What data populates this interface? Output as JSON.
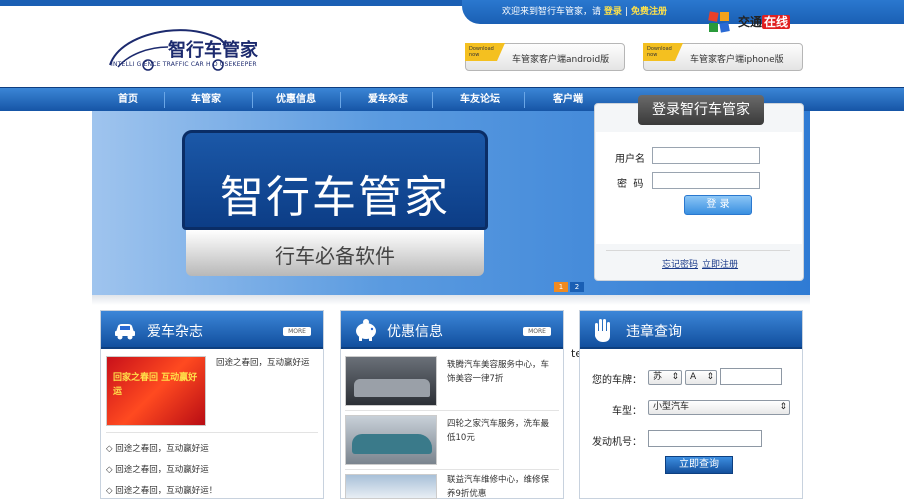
{
  "header": {
    "welcome": "欢迎来到智行车管家，请",
    "login_link": "登录",
    "separator": "|",
    "register_link": "免费注册",
    "logo_title": "智行车管家",
    "logo_sub": "INTELLI G ENCE TRAFFIC CAR H O USEKEEPER",
    "partner": "交通",
    "partner_highlight": "在线",
    "download_tag": "Download now",
    "download_android": "车管家客户端android版",
    "download_iphone": "车管家客户端iphone版"
  },
  "nav": {
    "items": [
      "首页",
      "车管家",
      "优惠信息",
      "爱车杂志",
      "车友论坛",
      "客户端"
    ]
  },
  "banner": {
    "title": "智行车管家",
    "subtitle": "行车必备软件",
    "pages": [
      "1",
      "2"
    ]
  },
  "login": {
    "title": "登录智行车管家",
    "username_label": "用户名",
    "password_label": "密  码",
    "submit": "登  录",
    "forgot": "忘记密码",
    "register": "立即注册"
  },
  "magazine": {
    "title": "爱车杂志",
    "more": "MORE",
    "image_caption": "回家之春回 互动赢好运",
    "headline": "回途之春回，互动赢好运",
    "items": [
      "回途之春回，互动赢好运",
      "回途之春回，互动赢好运",
      "回途之春回，互动赢好运！"
    ]
  },
  "deals": {
    "title": "优惠信息",
    "more": "MORE",
    "items": [
      "轶腾汽车美容服务中心，车饰美容一律7折",
      "四轮之家汽车服务，洗车最低10元",
      "联益汽车维修中心，维修保养9折优惠"
    ]
  },
  "stray_text": "te",
  "query": {
    "title": "违章查询",
    "plate_label": "您的车牌：",
    "province": "苏",
    "letter": "A",
    "type_label": "车型：",
    "type_value": "小型汽车",
    "engine_label": "发动机号：",
    "submit": "立即查询"
  },
  "colors": {
    "brand_blue": "#1a5fb4",
    "link_yellow": "#ffe24a"
  }
}
